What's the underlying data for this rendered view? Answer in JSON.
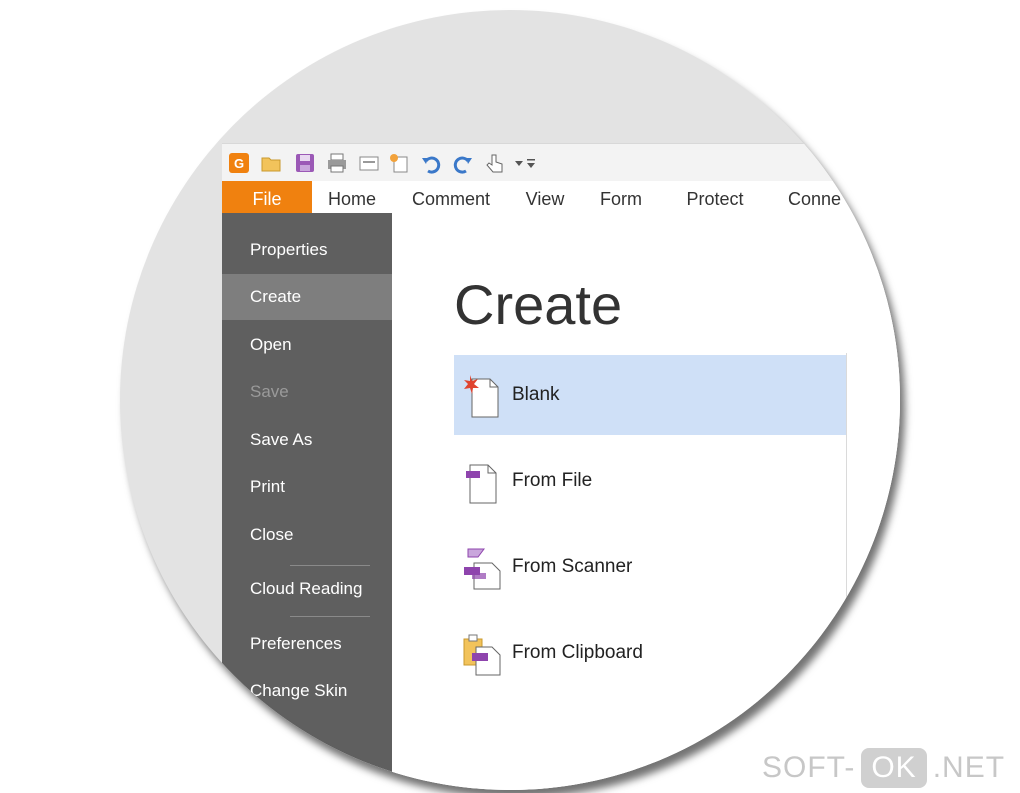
{
  "quick_access": {
    "icons": [
      "app-logo-icon",
      "open-folder-icon",
      "save-icon",
      "print-icon",
      "scan-icon",
      "new-icon",
      "undo-icon",
      "redo-icon",
      "hand-tool-icon",
      "customize-toolbar-icon"
    ]
  },
  "ribbon": {
    "tabs": [
      {
        "label": "File",
        "active": true
      },
      {
        "label": "Home"
      },
      {
        "label": "Comment"
      },
      {
        "label": "View"
      },
      {
        "label": "Form"
      },
      {
        "label": "Protect"
      },
      {
        "label": "Conne"
      }
    ]
  },
  "sidebar": {
    "items": [
      {
        "label": "Properties"
      },
      {
        "label": "Create",
        "selected": true
      },
      {
        "label": "Open"
      },
      {
        "label": "Save",
        "disabled": true
      },
      {
        "label": "Save As"
      },
      {
        "label": "Print"
      },
      {
        "label": "Close"
      },
      {
        "label": "Cloud Reading"
      },
      {
        "label": "Preferences"
      },
      {
        "label": "Change Skin"
      }
    ]
  },
  "content": {
    "title": "Create",
    "options": [
      {
        "label": "Blank",
        "icon": "blank-document-icon",
        "highlighted": true
      },
      {
        "label": "From File",
        "icon": "from-file-icon"
      },
      {
        "label": "From Scanner",
        "icon": "scanner-icon"
      },
      {
        "label": "From Clipboard",
        "icon": "clipboard-icon"
      }
    ]
  },
  "watermark": {
    "left": "SOFT-",
    "middle": "OK",
    "right": ".NET"
  },
  "colors": {
    "accent": "#f0810f",
    "sidebar": "#5f5f5f",
    "sidebar_selected": "#7e7e7e",
    "highlight": "#cfe0f7",
    "purple": "#8e44ad"
  }
}
